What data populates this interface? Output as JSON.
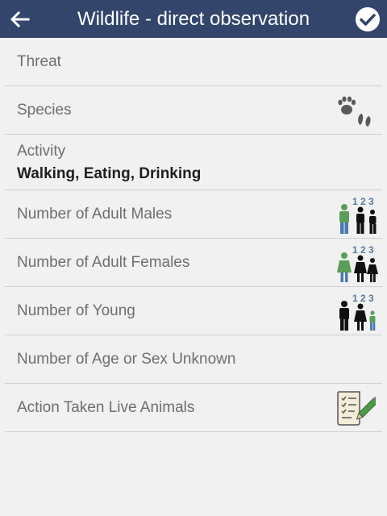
{
  "header": {
    "title": "Wildlife - direct observation"
  },
  "rows": [
    {
      "label": "Threat"
    },
    {
      "label": "Species",
      "icon": "paw-prints-icon"
    },
    {
      "label": "Activity",
      "value": "Walking, Eating, Drinking"
    },
    {
      "label": "Number of Adult Males",
      "icon": "adult-males-count-icon",
      "counter": "1 2 3"
    },
    {
      "label": "Number of Adult Females",
      "icon": "adult-females-count-icon",
      "counter": "1 2 3"
    },
    {
      "label": "Number of Young",
      "icon": "young-count-icon",
      "counter": "1 2 3"
    },
    {
      "label": "Number of Age or Sex Unknown"
    },
    {
      "label": "Action Taken Live Animals",
      "icon": "checklist-form-icon"
    }
  ],
  "colors": {
    "appbar": "#33456b",
    "background": "#f1f1f1",
    "label": "#6e6e6e",
    "value": "#1f1f1f",
    "divider": "#cfcfcf",
    "counter_digits": "#5a7a9a"
  }
}
